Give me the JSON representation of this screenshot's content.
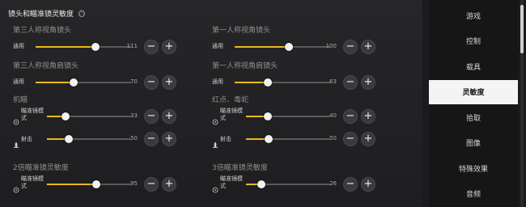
{
  "header": {
    "title": "镜头和瞄准镜灵敏度",
    "info_icon": "ⓘ"
  },
  "left": {
    "sections": [
      {
        "title": "第三人称视角镜头",
        "rows": [
          {
            "label": "通用",
            "value": "111",
            "fraction": 0.63
          }
        ]
      },
      {
        "title": "第三人称视角肩镜头",
        "rows": [
          {
            "label": "通用",
            "value": "70",
            "fraction": 0.4
          }
        ]
      },
      {
        "title": "机瞄",
        "rows": [
          {
            "label": "瞄准镜模式",
            "icon": "crosshair-icon",
            "value": "33",
            "fraction": 0.22
          },
          {
            "label": "射击",
            "icon": "fire-icon",
            "value": "50",
            "fraction": 0.26
          }
        ]
      },
      {
        "title": "2倍瞄准镜灵敏度",
        "rows": [
          {
            "label": "瞄准镜模式",
            "icon": "crosshair-icon",
            "value": "95",
            "fraction": 0.59
          }
        ]
      }
    ]
  },
  "right": {
    "sections": [
      {
        "title": "第一人称视角镜头",
        "rows": [
          {
            "label": "通用",
            "value": "100",
            "fraction": 0.57
          }
        ]
      },
      {
        "title": "第一人称视角肩镜头",
        "rows": [
          {
            "label": "通用",
            "value": "63",
            "fraction": 0.35
          }
        ]
      },
      {
        "title": "红点、毒蛇",
        "rows": [
          {
            "label": "瞄准镜模式",
            "icon": "crosshair-icon",
            "value": "40",
            "fraction": 0.26
          },
          {
            "label": "射击",
            "icon": "fire-icon",
            "value": "50",
            "fraction": 0.27
          }
        ]
      },
      {
        "title": "3倍瞄准镜灵敏度",
        "rows": [
          {
            "label": "瞄准镜模式",
            "icon": "crosshair-icon",
            "value": "26",
            "fraction": 0.18
          }
        ]
      }
    ]
  },
  "controls": {
    "minus": "−",
    "plus": "+"
  },
  "sidebar": {
    "items": [
      {
        "label": "游戏",
        "active": false
      },
      {
        "label": "控制",
        "active": false
      },
      {
        "label": "载具",
        "active": false
      },
      {
        "label": "灵敏度",
        "active": true
      },
      {
        "label": "拾取",
        "active": false
      },
      {
        "label": "图像",
        "active": false
      },
      {
        "label": "特殊效果",
        "active": false
      },
      {
        "label": "音频",
        "active": false
      }
    ]
  },
  "colors": {
    "accent": "#e8b922",
    "active_bg": "#f4f4f4"
  }
}
